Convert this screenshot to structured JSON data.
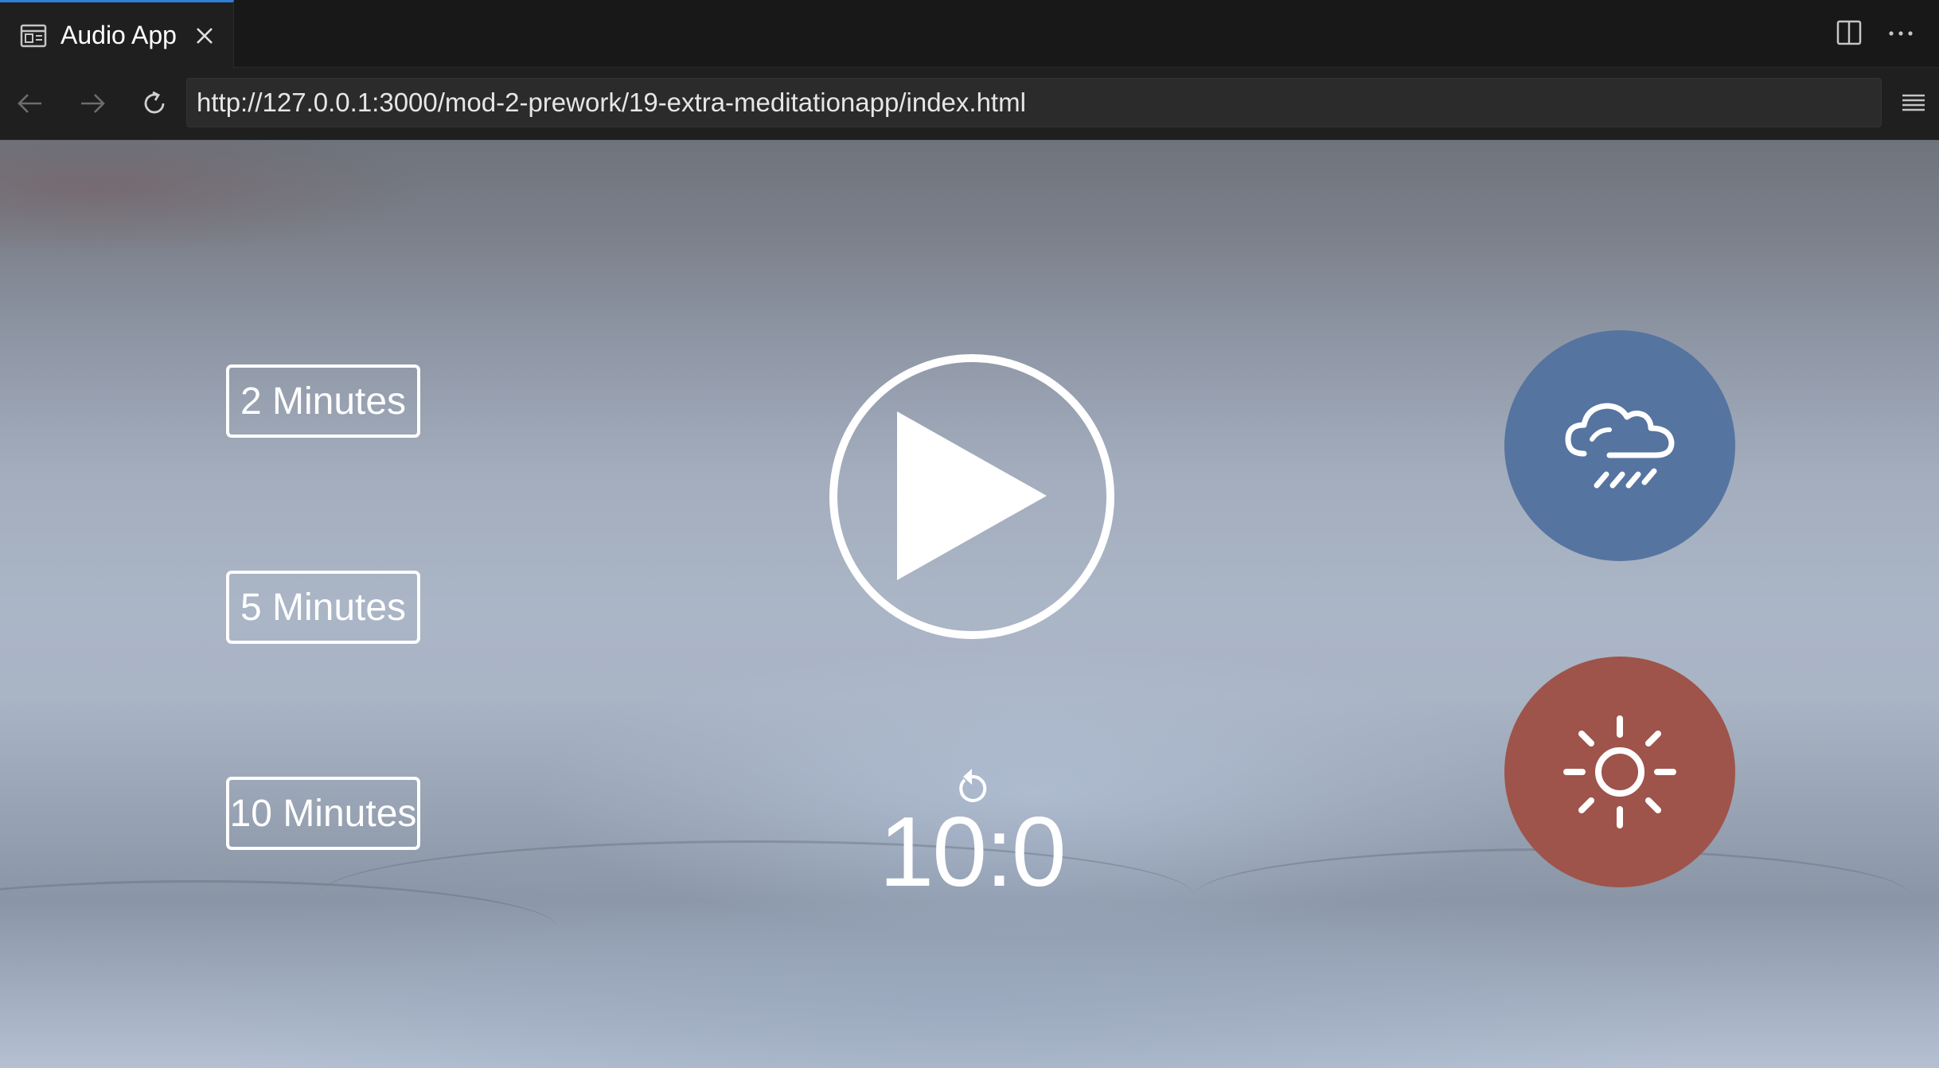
{
  "tab": {
    "title": "Audio App",
    "icon": "preview-icon",
    "close_icon": "close-icon"
  },
  "tab_actions": {
    "split_icon": "split-editor-icon",
    "more_icon": "more-actions-icon"
  },
  "nav": {
    "back_icon": "arrow-left-icon",
    "forward_icon": "arrow-right-icon",
    "reload_icon": "reload-icon",
    "url": "http://127.0.0.1:3000/mod-2-prework/19-extra-meditationapp/index.html",
    "menu_icon": "hamburger-menu-icon"
  },
  "app": {
    "durations": [
      {
        "label": "2 Minutes"
      },
      {
        "label": "5 Minutes"
      },
      {
        "label": "10 Minutes"
      }
    ],
    "play_icon": "play-icon",
    "replay_icon": "replay-icon",
    "timer": "10:0",
    "sounds": [
      {
        "name": "rain",
        "icon": "rain-cloud-icon",
        "color": "#5674a0"
      },
      {
        "name": "sun",
        "icon": "sun-icon",
        "color": "#9e544a"
      }
    ]
  },
  "colors": {
    "accent_tab": "#2f7fd8",
    "chrome_bg": "#1f1f1f",
    "text": "#ffffff"
  }
}
